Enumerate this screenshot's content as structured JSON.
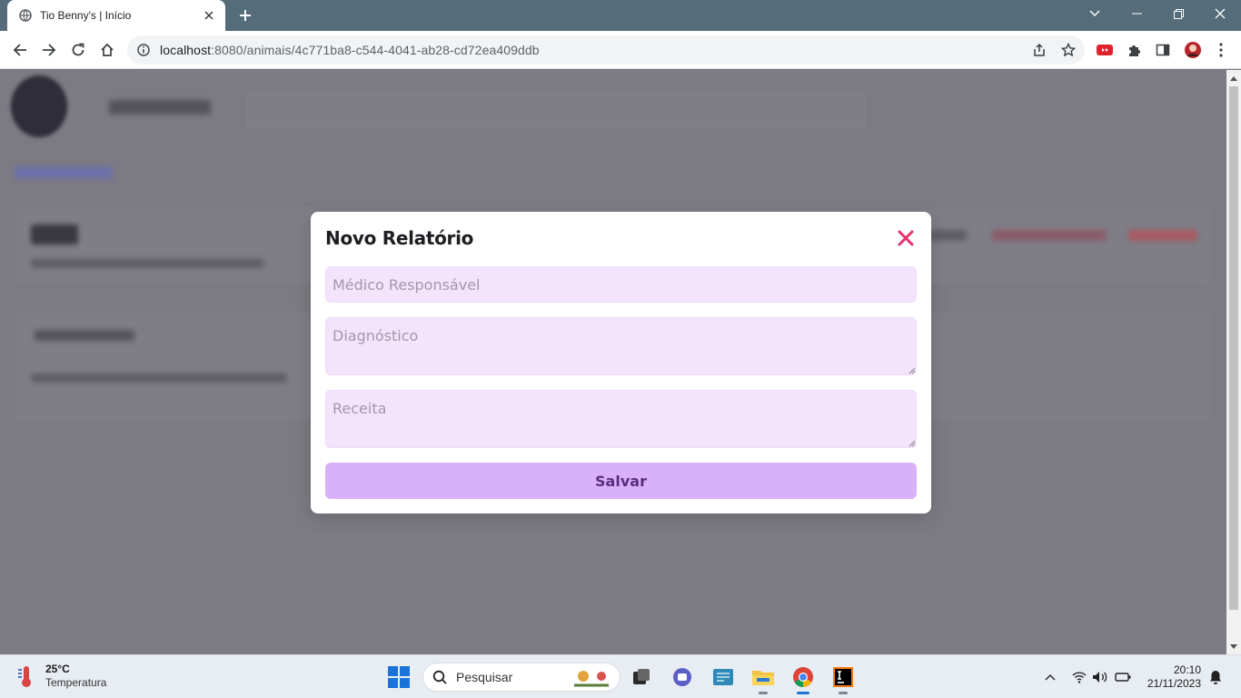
{
  "browser": {
    "tab_title": "Tio Benny's | Início",
    "url_host": "localhost",
    "url_path": ":8080/animais/4c771ba8-c544-4041-ab28-cd72ea409ddb",
    "new_tab_symbol": "+"
  },
  "modal": {
    "title": "Novo Relatório",
    "fields": {
      "medico_placeholder": "Médico Responsável",
      "diagnostico_placeholder": "Diagnóstico",
      "receita_placeholder": "Receita"
    },
    "save_label": "Salvar",
    "colors": {
      "close": "#e8336b",
      "field_bg": "#f3e3fd",
      "button_bg": "#d9b0fa",
      "button_text": "#5b2d7e"
    }
  },
  "taskbar": {
    "weather_temp": "25°C",
    "weather_desc": "Temperatura",
    "search_label": "Pesquisar",
    "time": "20:10",
    "date": "21/11/2023"
  }
}
